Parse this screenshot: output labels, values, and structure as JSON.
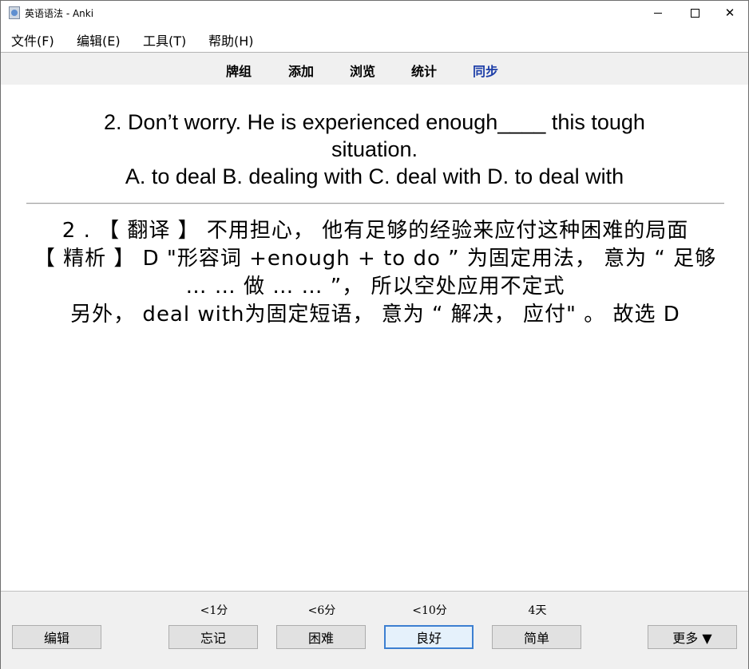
{
  "window": {
    "title": "英语语法 - Anki"
  },
  "menu": {
    "file": "文件(F)",
    "edit": "编辑(E)",
    "tools": "工具(T)",
    "help": "帮助(H)"
  },
  "toolbar": {
    "decks": "牌组",
    "add": "添加",
    "browse": "浏览",
    "stats": "统计",
    "sync": "同步"
  },
  "card": {
    "question": {
      "line1": "2. Don’t worry. He is experienced enough____ this tough",
      "line2": "situation.",
      "line3": "A. to deal B. dealing with C. deal with D. to deal with"
    },
    "answer": {
      "line1": "2 . 【 翻译 】 不用担心， 他有足够的经验来应付这种困难的局面",
      "line2": "【 精析 】 D \"形容词 +enough + to do ” 为固定用法， 意为 “ 足够",
      "line3": "… … 做 … … ”， 所以空处应用不定式",
      "line4": "另外， deal with为固定短语， 意为 “ 解决， 应付\" 。 故选 D"
    }
  },
  "review": {
    "edit_label": "编辑",
    "again": {
      "interval": "<1分",
      "label": "忘记"
    },
    "hard": {
      "interval": "<6分",
      "label": "困难"
    },
    "good": {
      "interval": "<10分",
      "label": "良好"
    },
    "easy": {
      "interval": "4天",
      "label": "简单"
    },
    "more_label": "更多 ▼"
  }
}
